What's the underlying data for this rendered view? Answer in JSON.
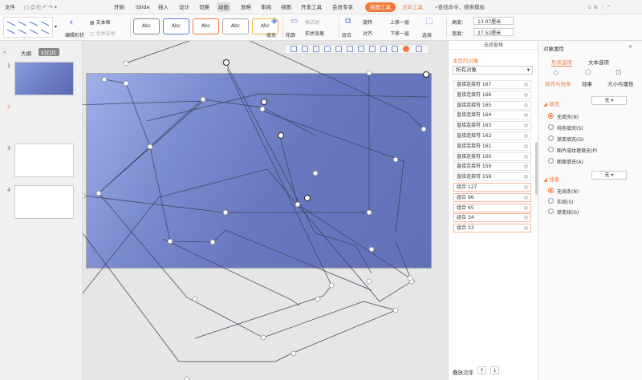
{
  "menu": {
    "file": "文件",
    "items": [
      "开始",
      "iSlide",
      "插入",
      "设计",
      "切换",
      "动画",
      "放映",
      "审阅",
      "视图",
      "开发工具",
      "会员专享"
    ],
    "active_index": 5,
    "context_tab1": "绘图工具",
    "context_tab2": "文本工具",
    "search": "查找命令、搜索模板"
  },
  "ribbon": {
    "edit_shape": "编辑形状",
    "textbox": "文本框",
    "merge_shape": "合并形状",
    "style_label": "Abc",
    "fill": "填充",
    "outline": "轮廓",
    "format_painter": "格式刷",
    "shape_effect": "形状效果",
    "group": "组合",
    "rotate": "旋转",
    "align": "对齐",
    "up_layer": "上移一层",
    "down_layer": "下移一层",
    "select": "选择",
    "height_label": "高度：",
    "height_value": "13.07厘米",
    "width_label": "宽度：",
    "width_value": "27.52厘米"
  },
  "left_panel": {
    "tab_outline": "大纲",
    "tab_slides": "幻灯片",
    "slides": [
      "1",
      "2",
      "3",
      "4"
    ]
  },
  "selection_pane": {
    "header": "选择窗格",
    "title": "本页的对象",
    "filter": "所有对象",
    "objects": [
      "直接连接符 167",
      "直接连接符 166",
      "直接连接符 165",
      "直接连接符 164",
      "直接连接符 163",
      "直接连接符 162",
      "直接连接符 161",
      "直接连接符 160",
      "直接连接符 159",
      "直接连接符 158",
      "组合 127",
      "组合 96",
      "组合 65",
      "组合 34",
      "组合 33"
    ],
    "order_label": "叠放次序"
  },
  "properties": {
    "title": "对象属性",
    "tab_shape": "形状选项",
    "tab_text": "文本选项",
    "sub_fill": "填充与线条",
    "sub_effect": "效果",
    "sub_size": "大小与属性",
    "fill_section": "填充",
    "fill_value": "无",
    "fill_options": [
      "无填充(N)",
      "纯色填充(S)",
      "渐变填充(G)",
      "图片或纹理填充(P)",
      "图案填充(A)"
    ],
    "line_section": "线条",
    "line_value": "无",
    "line_options": [
      "无线条(N)",
      "实线(S)",
      "渐变线(G)"
    ]
  },
  "colors": {
    "accent": "#f07a3a",
    "slide_bg": "#6f7fc6"
  }
}
